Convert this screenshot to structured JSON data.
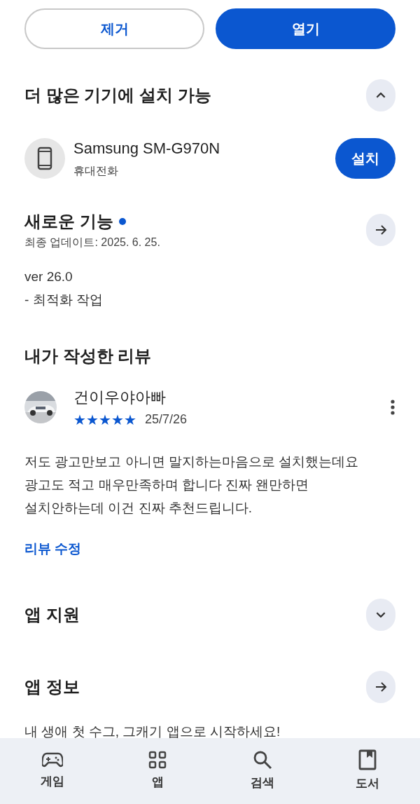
{
  "actions": [
    {
      "label": "제거",
      "kind": "outline"
    },
    {
      "label": "열기",
      "kind": "filled"
    }
  ],
  "devices_section": {
    "title": "더 많은 기기에 설치 가능",
    "expanded": true,
    "devices": [
      {
        "name": "Samsung SM-G970N",
        "type": "휴대전화",
        "button": "설치"
      }
    ]
  },
  "whats_new": {
    "title": "새로운 기능",
    "new": true,
    "updated": "최종 업데이트: 2025. 6. 25.",
    "notes": [
      "ver 26.0",
      "- 최적화 작업"
    ]
  },
  "my_review": {
    "title": "내가 작성한 리뷰",
    "author": "건이우야아빠",
    "stars": 5,
    "date": "25/7/26",
    "text": "저도 광고만보고 아니면 말지하는마음으로 설치했는데요 광고도 적고 매우만족하며 합니다 진짜 왠만하면 설치안하는데 이건 진짜 추천드립니다.",
    "edit_link": "리뷰 수정"
  },
  "app_support": {
    "title": "앱 지원",
    "expanded": false
  },
  "app_info": {
    "title": "앱 정보",
    "tagline": "내 생애 첫 수그, 그캐기 앱으로 시작하세요!"
  },
  "bottom_nav": [
    {
      "label": "게임",
      "kind": "games",
      "selected": false
    },
    {
      "label": "앱",
      "kind": "apps",
      "selected": false
    },
    {
      "label": "검색",
      "kind": "search",
      "selected": false
    },
    {
      "label": "도서",
      "kind": "books",
      "selected": false
    }
  ]
}
